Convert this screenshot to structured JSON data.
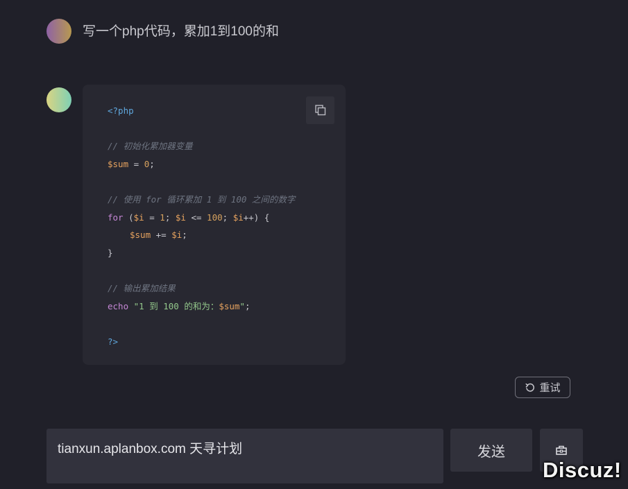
{
  "conversation": {
    "question": "写一个php代码，累加1到100的和",
    "code_lines": [
      [
        {
          "t": "<?php",
          "c": "kw-tag"
        }
      ],
      [],
      [
        {
          "t": "// 初始化累加器变量",
          "c": "cm"
        }
      ],
      [
        {
          "t": "$sum",
          "c": "var"
        },
        {
          "t": " = ",
          "c": "op"
        },
        {
          "t": "0",
          "c": "num"
        },
        {
          "t": ";",
          "c": "op"
        }
      ],
      [],
      [
        {
          "t": "// 使用 for 循环累加 1 到 100 之间的数字",
          "c": "cm"
        }
      ],
      [
        {
          "t": "for",
          "c": "kw"
        },
        {
          "t": " (",
          "c": "op"
        },
        {
          "t": "$i",
          "c": "var"
        },
        {
          "t": " = ",
          "c": "op"
        },
        {
          "t": "1",
          "c": "num"
        },
        {
          "t": "; ",
          "c": "op"
        },
        {
          "t": "$i",
          "c": "var"
        },
        {
          "t": " <= ",
          "c": "op"
        },
        {
          "t": "100",
          "c": "num"
        },
        {
          "t": "; ",
          "c": "op"
        },
        {
          "t": "$i",
          "c": "var"
        },
        {
          "t": "++) {",
          "c": "op"
        }
      ],
      [
        {
          "t": "$sum",
          "c": "var",
          "indent": true
        },
        {
          "t": " += ",
          "c": "op"
        },
        {
          "t": "$i",
          "c": "var"
        },
        {
          "t": ";",
          "c": "op"
        }
      ],
      [
        {
          "t": "}",
          "c": "op"
        }
      ],
      [],
      [
        {
          "t": "// 输出累加结果",
          "c": "cm"
        }
      ],
      [
        {
          "t": "echo",
          "c": "kw"
        },
        {
          "t": " \"1 到 100 的和为：",
          "c": "str"
        },
        {
          "t": "$sum",
          "c": "var"
        },
        {
          "t": "\"",
          "c": "str"
        },
        {
          "t": ";",
          "c": "op"
        }
      ],
      [],
      [
        {
          "t": "?>",
          "c": "kw-tag"
        }
      ]
    ],
    "copy_icon": "copy-icon",
    "retry_label": "重试",
    "retry_icon": "refresh-icon"
  },
  "composer": {
    "input_value": "tianxun.aplanbox.com 天寻计划",
    "send_label": "发送",
    "extra_icon": "briefcase-icon"
  },
  "watermark": "Discuz!",
  "colors": {
    "background": "#202029",
    "card": "#282831",
    "keyword": "#c587d5",
    "variable": "#e7a35f",
    "string": "#93c78b",
    "comment": "#6e7481",
    "tag": "#5fa7dd"
  }
}
